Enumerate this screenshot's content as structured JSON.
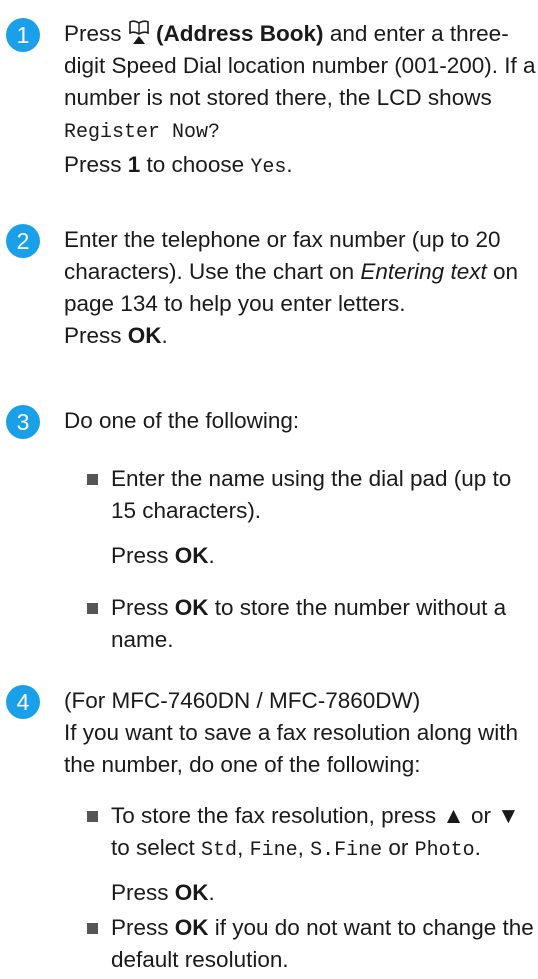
{
  "steps": [
    {
      "num": "1",
      "press": "Press ",
      "addressbook": "(Address Book)",
      "t1": " and enter a three-digit Speed Dial location number (001-200). If a number is not stored there, the LCD shows ",
      "register": "Register Now?",
      "press2": "Press ",
      "one": "1",
      "t2": " to choose ",
      "yes": "Yes",
      "dot": "."
    },
    {
      "num": "2",
      "t1": "Enter the telephone or fax number (up to 20 characters). Use the chart on ",
      "link": "Entering text",
      "t2": " on page 134 to help you enter letters.",
      "press": "Press ",
      "ok": "OK",
      "dot": "."
    },
    {
      "num": "3",
      "text": "Do one of the following:",
      "b1": "Enter the name using the dial pad (up to 15 characters).",
      "b1_press": "Press ",
      "b1_ok": "OK",
      "b1_dot": ".",
      "b2_press": "Press ",
      "b2_ok": "OK",
      "b2_rest": " to store the number without a name."
    },
    {
      "num": "4",
      "l1": "(For MFC-7460DN / MFC-7860DW)",
      "l2": "If you want to save a fax resolution along with the number, do one of the following:",
      "b1_a": "To store the fax resolution, press ",
      "b1_up": "▲",
      "b1_or": " or ",
      "b1_down": "▼",
      "b1_b": " to select ",
      "std": "Std",
      "comma1": ", ",
      "fine": "Fine",
      "comma2": ", ",
      "sfine": "S.Fine",
      "or2": " or ",
      "photo": "Photo",
      "dot": ".",
      "b1_press": "Press ",
      "b1_ok": "OK",
      "b1_dot": ".",
      "b2_press": "Press ",
      "b2_ok": "OK",
      "b2_rest": " if you do not want to change the default resolution."
    }
  ],
  "colors": {
    "step_circle": "#1aa0e8",
    "bullet": "#555555"
  },
  "icons": {
    "address_book": "address-book-icon"
  }
}
